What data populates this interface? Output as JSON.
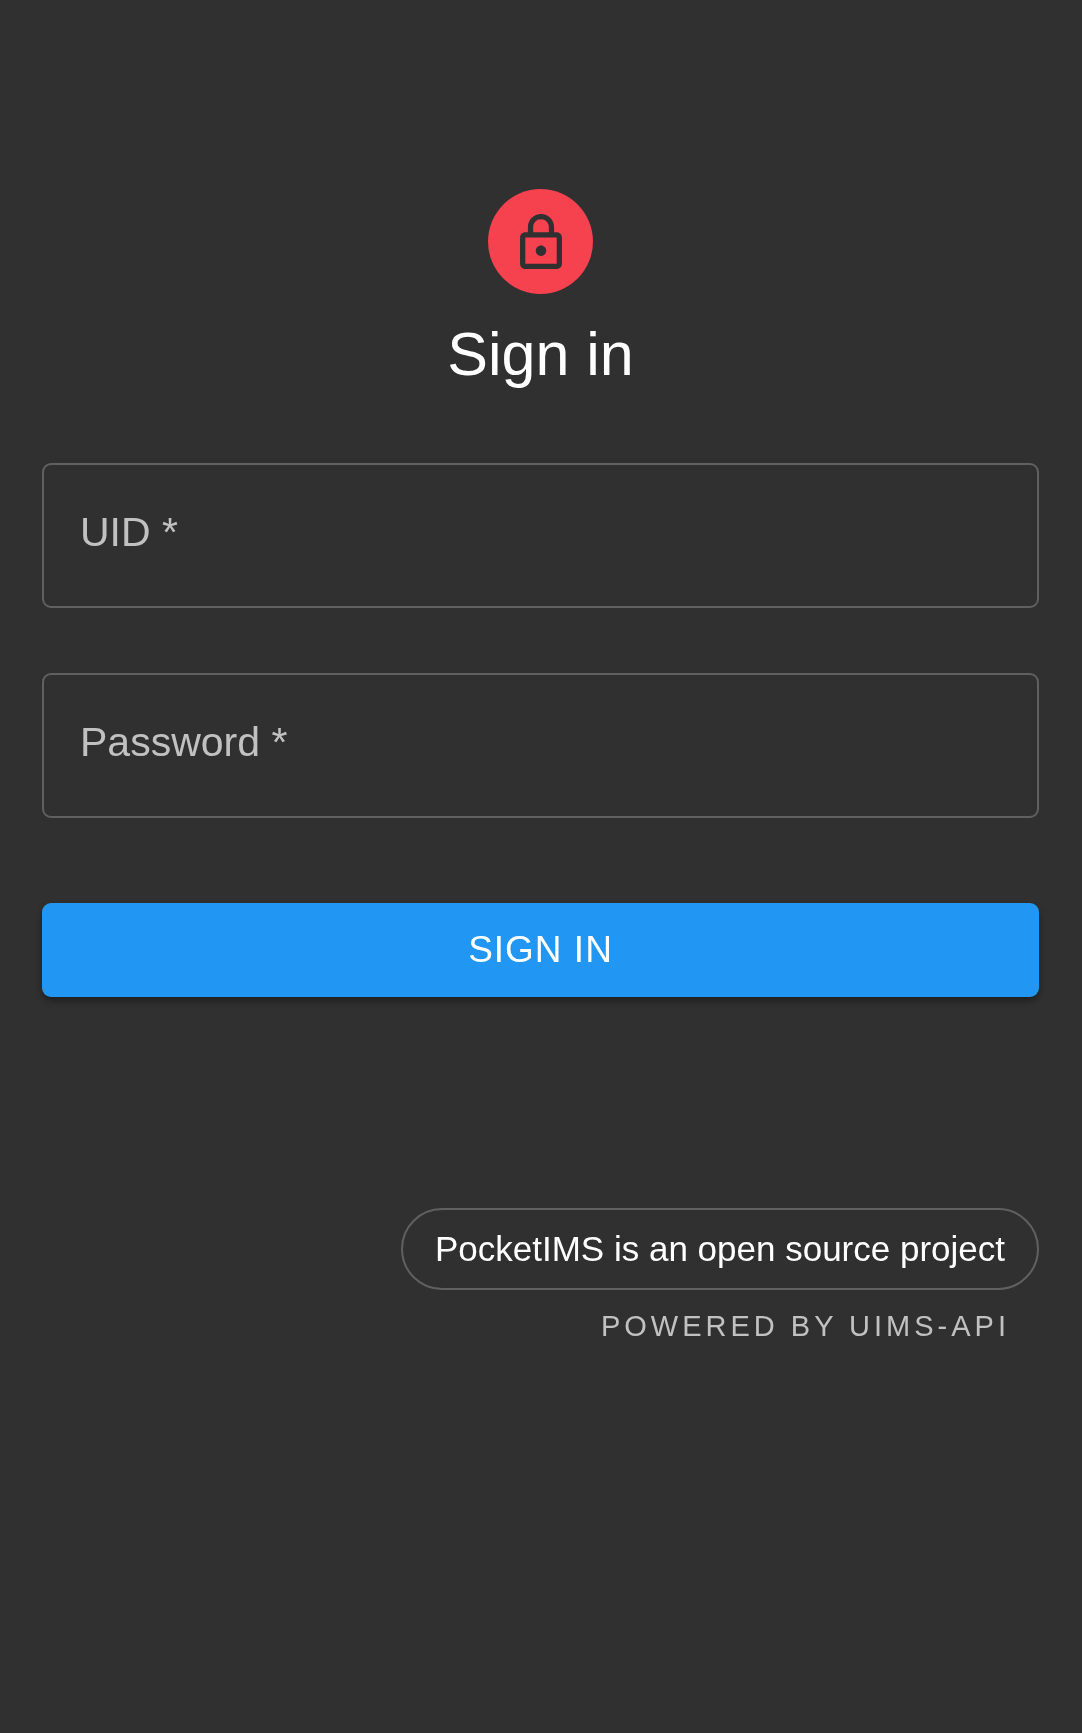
{
  "title": "Sign in",
  "fields": [
    {
      "placeholder": "UID *"
    },
    {
      "placeholder": "Password *"
    }
  ],
  "submit_button": "SIGN IN",
  "footer": {
    "project_link": "PocketIMS is an open source project",
    "powered_by": "POWERED BY UIMS-API"
  }
}
